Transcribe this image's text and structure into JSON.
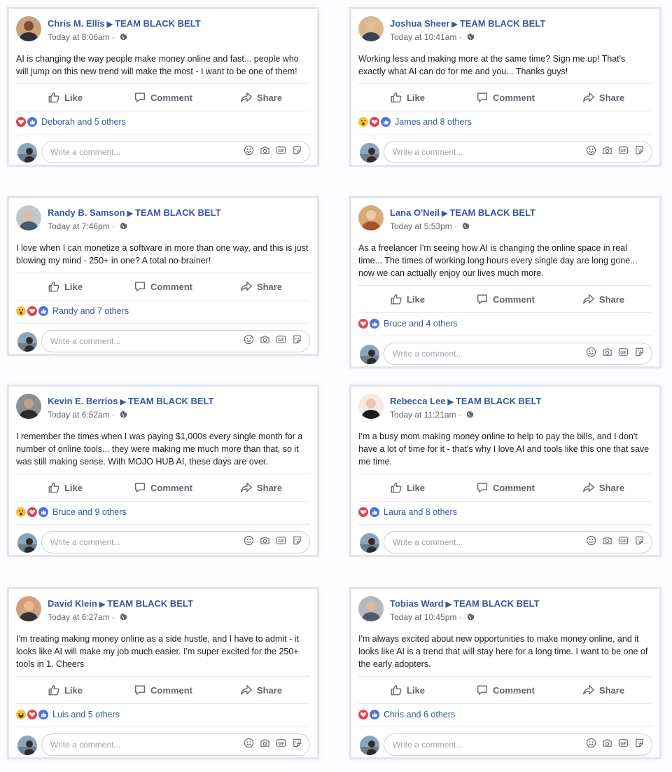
{
  "actions": {
    "like": "Like",
    "comment": "Comment",
    "share": "Share"
  },
  "composer_placeholder": "Write a comment...",
  "group": "TEAM BLACK BELT",
  "colors": {
    "link": "#385898",
    "like_blue": "#4a76e0",
    "love_red": "#e8414f",
    "wow_yellow": "#f5c33b"
  },
  "posts": [
    {
      "name": "Chris M. Ellis",
      "time": "Today at 8:06am",
      "text": "AI is changing the way people make money online and fast... people who will jump on this new trend will make the most - I want to be one of them!",
      "reactions": "Deborah and 5 others",
      "reaction_icons": [
        "love",
        "like"
      ]
    },
    {
      "name": "Joshua Sheer",
      "time": "Today at 10:41am",
      "text": "Working less and making more at the same time? Sign me up! That's exactly what AI can do for me and you... Thanks guys!",
      "reactions": "James and 8 others",
      "reaction_icons": [
        "wow",
        "love",
        "like"
      ]
    },
    {
      "name": "Randy B. Samson",
      "time": "Today at 7:46pm",
      "text": "I love when I can monetize a software in more than one way, and this is just blowing my mind - 250+ in one? A total no-brainer!",
      "reactions": "Randy and 7 others",
      "reaction_icons": [
        "wow",
        "love",
        "like"
      ]
    },
    {
      "name": "Lana O'Neil",
      "time": "Today at 5:53pm",
      "text": "As a freelancer I'm seeing how AI is changing the online space in real time... The times of working long hours every single day are long gone... now we can actually enjoy our lives much more.",
      "reactions": "Bruce and 4 others",
      "reaction_icons": [
        "love",
        "like"
      ]
    },
    {
      "name": "Kevin E. Berrios",
      "time": "Today at 6:52am",
      "text": "I remember the times when I was paying $1,000s every single month for a number of online tools... they were making me much more than that, so it was still making sense. With MOJO HUB AI, these days are over.",
      "reactions": "Bruce and 9 others",
      "reaction_icons": [
        "wow",
        "love",
        "like"
      ]
    },
    {
      "name": "Rebecca Lee",
      "time": "Today at 11:21am",
      "text": "I'm a busy mom making money online to help to pay the bills, and I don't have a lot of time for it - that's why I love AI and tools like this one that save me time.",
      "reactions": "Laura and 8 others",
      "reaction_icons": [
        "love",
        "like"
      ]
    },
    {
      "name": "David Klein",
      "time": "Today at 6:27am",
      "text": "I'm treating making money online as a side hustle, and I have to admit - it looks like AI will make my job much easier. I'm super excited for the 250+ tools in 1. Cheers",
      "reactions": "Luis and 5 others",
      "reaction_icons": [
        "haha",
        "love",
        "like"
      ]
    },
    {
      "name": "Tobias Ward",
      "time": "Today at 10:45pm",
      "text": "I'm always excited about new opportunities to make money online, and it looks like AI is a trend that will stay here for a long time. I want to be one of the early adopters.",
      "reactions": "Chris and 6 others",
      "reaction_icons": [
        "love",
        "like"
      ]
    }
  ]
}
